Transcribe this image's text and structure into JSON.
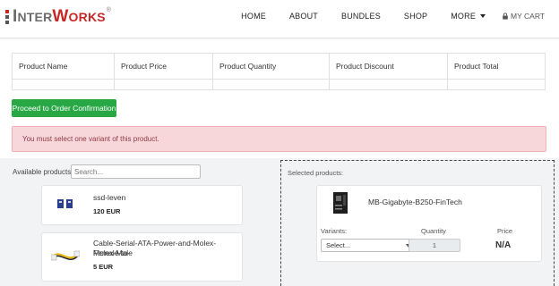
{
  "brand": {
    "logo_text": "InterWorks",
    "logo_prefix": "I",
    "logo_mid": "NTER",
    "logo_accent": "W",
    "logo_suffix": "ORKS",
    "accent_color": "#c62828"
  },
  "nav": {
    "items": [
      "HOME",
      "ABOUT",
      "BUNDLES",
      "SHOP",
      "MORE"
    ],
    "cart_label": "MY CART",
    "cart_icon": "lock-icon"
  },
  "order_table": {
    "headers": [
      "Product Name",
      "Product Price",
      "Product Quantity",
      "Product Discount",
      "Product Total"
    ]
  },
  "proceed_label": "Proceed to Order Confirmation",
  "alert_text": "You must select one variant of this product.",
  "available": {
    "label": "Available products:",
    "search_placeholder": "Search...",
    "products": [
      {
        "name": "ssd-leven",
        "price": "120 EUR",
        "icon": "ssd-icon"
      },
      {
        "name_line1": "Cable-Serial-ATA-Power-and-Molex-Female-to-",
        "name_line2": "Molex-Male",
        "price": "5 EUR",
        "icon": "cable-icon"
      }
    ]
  },
  "selected": {
    "label": "Selected products:",
    "product_name": "MB-Gigabyte-B250-FinTech",
    "icon": "motherboard-icon",
    "variants_label": "Variants:",
    "variant_value": "Select...",
    "quantity_label": "Quantity",
    "quantity_value": "1",
    "price_label": "Price",
    "price_value": "N/A"
  },
  "colors": {
    "success": "#28a745",
    "alert_bg": "#f8d7da",
    "alert_text": "#8b3a44"
  }
}
